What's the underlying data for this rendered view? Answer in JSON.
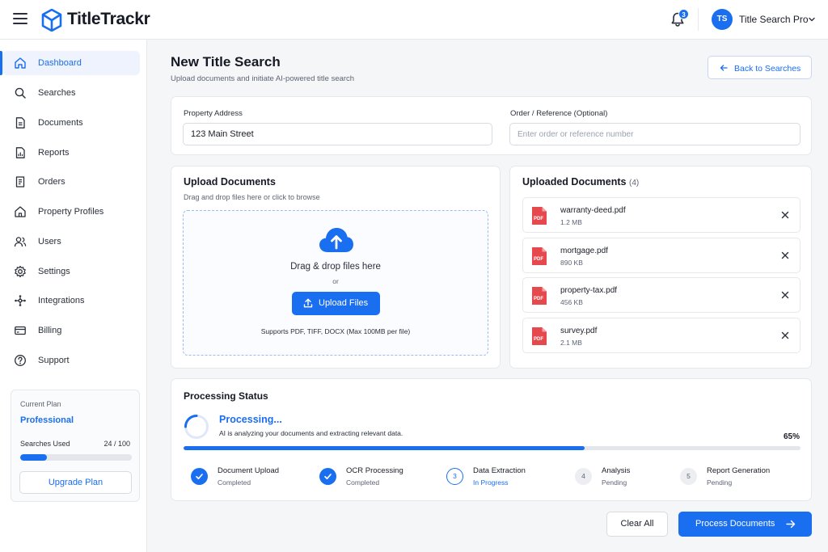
{
  "app": {
    "brand": "TitleTrackr",
    "notification_count": "3",
    "user_initials": "TS",
    "user_name": "Title Search Pro"
  },
  "sidebar": {
    "items": [
      {
        "label": "Dashboard",
        "icon": "home-icon",
        "active": true
      },
      {
        "label": "Searches",
        "icon": "search-icon"
      },
      {
        "label": "Documents",
        "icon": "document-icon"
      },
      {
        "label": "Reports",
        "icon": "report-icon"
      },
      {
        "label": "Orders",
        "icon": "orders-icon"
      },
      {
        "label": "Property Profiles",
        "icon": "house-icon"
      },
      {
        "label": "Users",
        "icon": "users-icon"
      },
      {
        "label": "Settings",
        "icon": "gear-icon"
      },
      {
        "label": "Integrations",
        "icon": "integrations-icon"
      },
      {
        "label": "Billing",
        "icon": "billing-icon"
      },
      {
        "label": "Support",
        "icon": "help-icon"
      }
    ],
    "plan": {
      "caption": "Current Plan",
      "name": "Professional",
      "used_label": "Searches Used",
      "used_value": "24 / 100",
      "used_fraction": 0.24,
      "upgrade_label": "Upgrade Plan"
    }
  },
  "page": {
    "title": "New Title Search",
    "subtitle": "Upload documents and initiate AI-powered title search",
    "back_label": "Back to Searches"
  },
  "form": {
    "address_label": "Property Address",
    "address_value": "123 Main Street",
    "ref_label": "Order / Reference (Optional)",
    "ref_placeholder": "Enter order or reference number"
  },
  "upload": {
    "title": "Upload Documents",
    "subtitle": "Drag and drop files here or click to browse",
    "drop_text": "Drag & drop files here",
    "or_text": "or",
    "button_label": "Upload Files",
    "note": "Supports PDF, TIFF, DOCX (Max 100MB per file)"
  },
  "uploaded": {
    "title": "Uploaded Documents",
    "count": "(4)",
    "file_badge": "PDF",
    "files": [
      {
        "name": "warranty-deed.pdf",
        "size": "1.2 MB"
      },
      {
        "name": "mortgage.pdf",
        "size": "890 KB"
      },
      {
        "name": "property-tax.pdf",
        "size": "456 KB"
      },
      {
        "name": "survey.pdf",
        "size": "2.1 MB"
      }
    ]
  },
  "processing": {
    "title": "Processing Status",
    "state": "Processing...",
    "message": "AI is analyzing your documents and extracting relevant data.",
    "percent_label": "65%",
    "percent": 65,
    "steps": [
      {
        "number": "1",
        "title": "Document Upload",
        "status": "Completed",
        "state": "done"
      },
      {
        "number": "2",
        "title": "OCR Processing",
        "status": "Completed",
        "state": "done"
      },
      {
        "number": "3",
        "title": "Data Extraction",
        "status": "In Progress",
        "state": "current"
      },
      {
        "number": "4",
        "title": "Analysis",
        "status": "Pending",
        "state": "pending"
      },
      {
        "number": "5",
        "title": "Report Generation",
        "status": "Pending",
        "state": "pending"
      }
    ]
  },
  "actions": {
    "clear_label": "Clear All",
    "process_label": "Process Documents"
  },
  "colors": {
    "accent": "#1a6ef0",
    "pdf_red": "#e5484d"
  }
}
